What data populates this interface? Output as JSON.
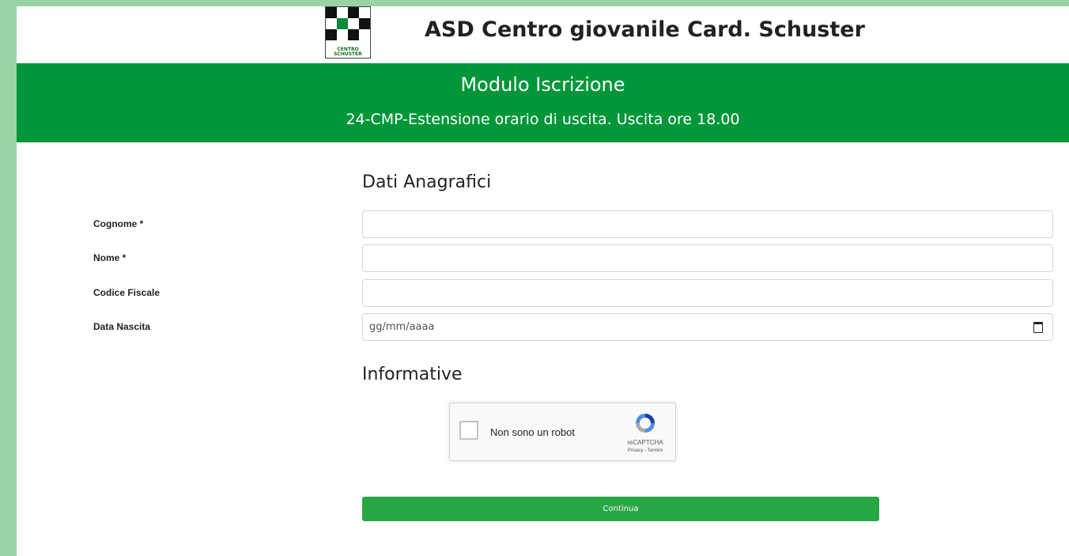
{
  "header": {
    "org_name": "ASD Centro giovanile Card. Schuster",
    "logo_text_1": "CENTRO",
    "logo_text_2": "SCHUSTER"
  },
  "banner": {
    "title": "Modulo Iscrizione",
    "subtitle": "24-CMP-Estensione orario di uscita. Uscita ore 18.00"
  },
  "form": {
    "section_personal": "Dati Anagrafici",
    "fields": [
      {
        "label": "Cognome *",
        "value": "",
        "placeholder": ""
      },
      {
        "label": "Nome *",
        "value": "",
        "placeholder": ""
      },
      {
        "label": "Codice Fiscale",
        "value": "",
        "placeholder": ""
      },
      {
        "label": "Data Nascita",
        "value": "",
        "placeholder": "gg/mm/aaaa"
      }
    ],
    "section_info": "Informative",
    "recaptcha": {
      "label": "Non sono un robot",
      "brand": "reCAPTCHA",
      "links": "Privacy - Termini"
    },
    "continue_label": "Continua"
  },
  "colors": {
    "banner_green": "#009639",
    "button_green": "#28a745",
    "outer_background": "#99d3a5"
  },
  "icons": [
    "logo-icon",
    "calendar-icon",
    "recaptcha-logo-icon"
  ]
}
